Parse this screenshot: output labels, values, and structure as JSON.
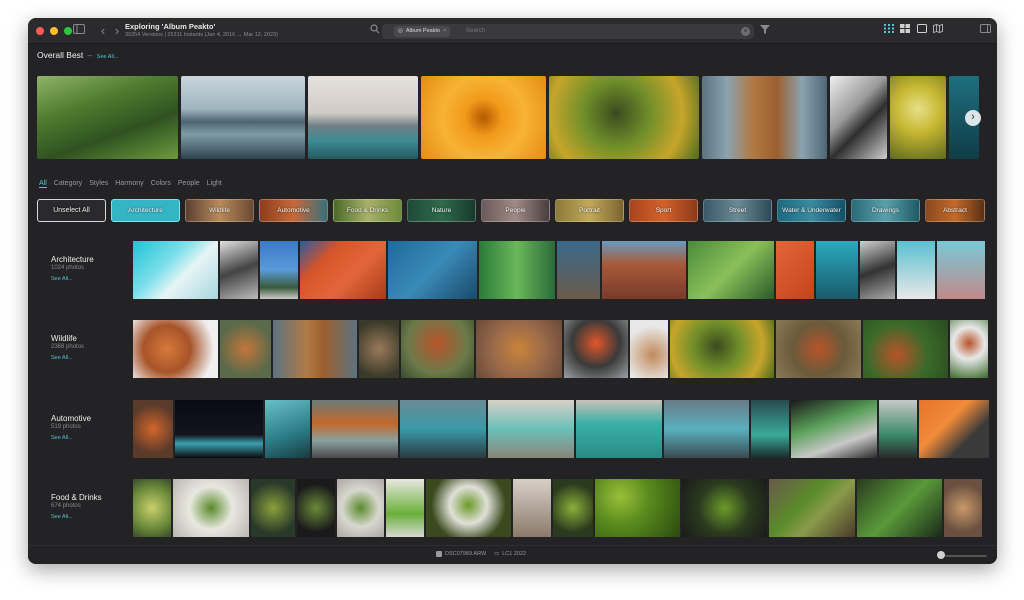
{
  "window": {
    "title": "Exploring 'Album Peakto'",
    "subtitle": "39354 Versions | 25311 Instants (Jan 4, 2016 → Mar 12, 2023)",
    "icons": [
      "sidebar-icon",
      "back-chevron-icon",
      "forward-chevron-icon",
      "grid-view-icon",
      "mosaic-view-icon",
      "single-view-icon",
      "map-view-icon",
      "panel-icon"
    ]
  },
  "search": {
    "chip_label": "Album Peakto",
    "placeholder": "Search",
    "icons": [
      "search-icon",
      "album-icon",
      "close-icon",
      "clear-icon",
      "filter-icon"
    ]
  },
  "overall_best": {
    "title": "Overall Best",
    "see_all": "See All..."
  },
  "tabs": [
    "All",
    "Category",
    "Styles",
    "Harmony",
    "Colors",
    "People",
    "Light"
  ],
  "active_tab": "All",
  "categories": [
    "Unselect All",
    "Architecture",
    "Wildlife",
    "Automotive",
    "Food & Drinks",
    "Nature",
    "People",
    "Portrait",
    "Sport",
    "Street",
    "Water & Underwater",
    "Drawings",
    "Abstract"
  ],
  "selected_category": "Architecture",
  "rows": [
    {
      "name": "Architecture",
      "count": "1024 photos",
      "see_all": "See All..."
    },
    {
      "name": "Wildlife",
      "count": "2368 photos",
      "see_all": "See All..."
    },
    {
      "name": "Automotive",
      "count": "519 photos",
      "see_all": "See All..."
    },
    {
      "name": "Food & Drinks",
      "count": "674 photos",
      "see_all": "See All..."
    }
  ],
  "status": {
    "file": "DSC07989.ARW",
    "folder": "LC1 2022"
  },
  "colors": {
    "accent": "#4fc7d4",
    "window_bg": "#232325",
    "selected_category": "#34b5c6"
  }
}
